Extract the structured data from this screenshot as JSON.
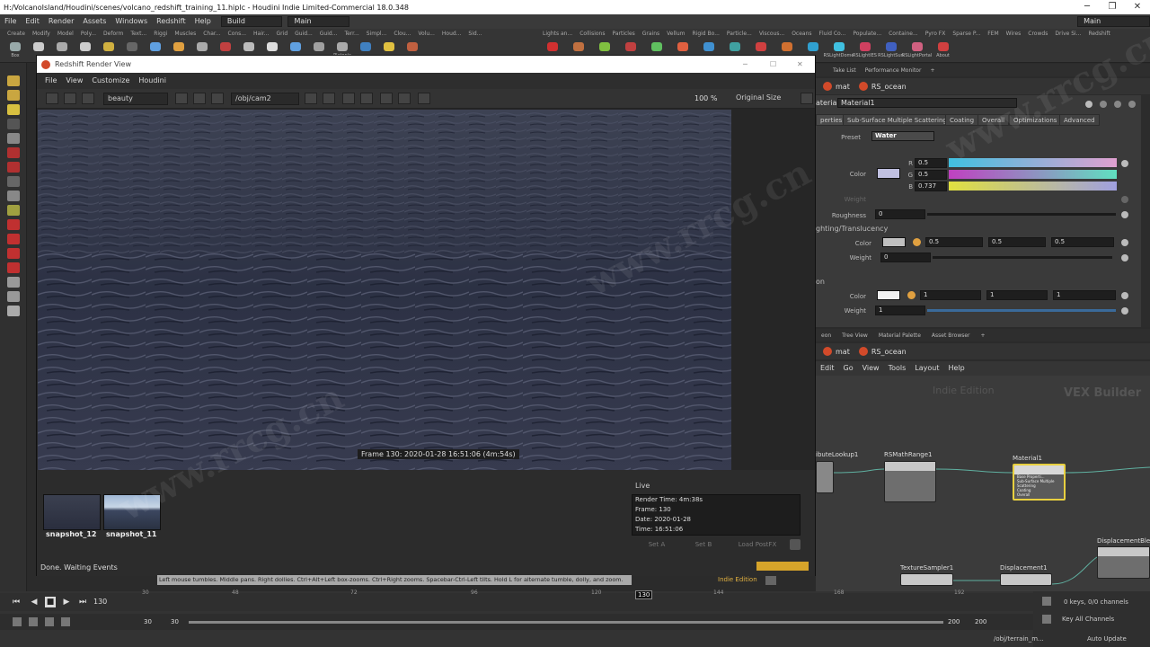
{
  "window": {
    "title": "H:/VolcanoIsland/Houdini/scenes/volcano_redshift_training_11.hiplc - Houdini Indie Limited-Commercial 18.0.348",
    "brand_watermark": "www.rrcg.cn"
  },
  "menubar": {
    "items": [
      "File",
      "Edit",
      "Render",
      "Assets",
      "Windows",
      "Redshift",
      "Help"
    ],
    "desktop": "Build",
    "context": "Main",
    "right_context": "Main"
  },
  "shelf": {
    "tabs_left": [
      "Create",
      "Modify",
      "Model",
      "Poly...",
      "Deform",
      "Text...",
      "Riggi",
      "Muscles",
      "Char...",
      "Cons...",
      "Hair...",
      "Grid",
      "Guid...",
      "Guid...",
      "Terr...",
      "Simpl...",
      "Clou...",
      "Volu...",
      "Houd...",
      "Sid..."
    ],
    "tabs_right": [
      "Lights an...",
      "Collisions",
      "Particles",
      "Grains",
      "Vellum",
      "Rigid Bo...",
      "Particle...",
      "Viscous...",
      "Oceans",
      "Fluid Co...",
      "Populate...",
      "Containe...",
      "Pyro FX",
      "Sparse P...",
      "FEM",
      "Wires",
      "Crowds",
      "Drive Si...",
      "Redshift"
    ],
    "tools_left": [
      "Box",
      "",
      "",
      "",
      "",
      "",
      "",
      "",
      "",
      "",
      "",
      "",
      "",
      "",
      "Platonic",
      "",
      "",
      ""
    ],
    "tools_right": [
      "",
      "",
      "",
      "",
      "",
      "",
      "",
      "",
      "",
      "",
      "",
      "RSLightDome",
      "RSLightIES",
      "RSLightSun",
      "RSLightPortal",
      "About"
    ]
  },
  "render_view": {
    "title": "Redshift Render View",
    "menu": [
      "File",
      "View",
      "Customize",
      "Houdini"
    ],
    "aov": "beauty",
    "camera": "/obj/cam2",
    "zoom": "100 %",
    "size_mode": "Original Size",
    "frame_overlay": "Frame  130:  2020-01-28  16:51:06  (4m:54s)",
    "snapshots": [
      {
        "label": "snapshot_12"
      },
      {
        "label": "snapshot_11"
      }
    ],
    "live_label": "Live",
    "live_info": [
      "Render Time: 4m:38s",
      "Frame: 130",
      "Date: 2020-01-28",
      "Time: 16:51:06"
    ],
    "buttons": [
      "Set A",
      "Set B",
      "Load PostFX"
    ],
    "status": "Done. Waiting Events"
  },
  "param_panel": {
    "top_tabs": [
      "Take List",
      "Performance Monitor"
    ],
    "path_root": "mat",
    "path_node": "RS_ocean",
    "node_type": "aterial",
    "node_name": "Material1",
    "tabs": [
      "perties",
      "Sub-Surface Multiple Scattering",
      "Coating",
      "Overall",
      "Optimizations",
      "Advanced"
    ],
    "preset_label": "Preset",
    "preset_value": "Water",
    "color_label": "Color",
    "rgb": [
      {
        "ch": "R",
        "value": "0.5"
      },
      {
        "ch": "G",
        "value": "0.5"
      },
      {
        "ch": "B",
        "value": "0.737"
      }
    ],
    "weight_label": "Weight",
    "roughness_label": "Roughness",
    "roughness_value": "0",
    "section_translucency": "ghting/Translucency",
    "trans_color_label": "Color",
    "trans_color": [
      "0.5",
      "0.5",
      "0.5"
    ],
    "trans_weight_label": "Weight",
    "trans_weight": "0",
    "section_on": "on",
    "em_color_label": "Color",
    "em_color": [
      "1",
      "1",
      "1"
    ],
    "em_weight_label": "Weight",
    "em_weight": "1"
  },
  "network_panel": {
    "tabs": [
      "eon",
      "Tree View",
      "Material Palette",
      "Asset Browser"
    ],
    "path_root": "mat",
    "path_node": "RS_ocean",
    "menu": [
      "Edit",
      "Go",
      "View",
      "Tools",
      "Layout",
      "Help"
    ],
    "edition_label": "Indie Edition",
    "vex_label": "VEX Builder",
    "nodes": [
      "ibuteLookup1",
      "RSMathRange1",
      "Material1",
      "DisplacementBlen",
      "TextureSampler1",
      "Displacement1"
    ],
    "material_inputs": [
      "Base Properti...",
      "Sub-Surface Multiple Scattering",
      "Coating",
      "Overall"
    ]
  },
  "statusbar": {
    "hint": "Left mouse tumbles. Middle pans. Right dollies. Ctrl+Alt+Left box-zooms. Ctrl+Right zooms. Spacebar-Ctrl-Left tilts. Hold L for alternate tumble, dolly, and zoom.",
    "edition": "Indie Edition"
  },
  "timeline": {
    "current_frame": "130",
    "marker": "130",
    "ticks": [
      "30",
      "48",
      "72",
      "96",
      "120",
      "144",
      "168",
      "192"
    ],
    "start": "30",
    "start2": "30",
    "end": "200",
    "end2": "200",
    "keys": "0 keys, 0/0 channels",
    "key_mode": "Key All Channels",
    "path": "/obj/terrain_m...",
    "update": "Auto Update"
  }
}
